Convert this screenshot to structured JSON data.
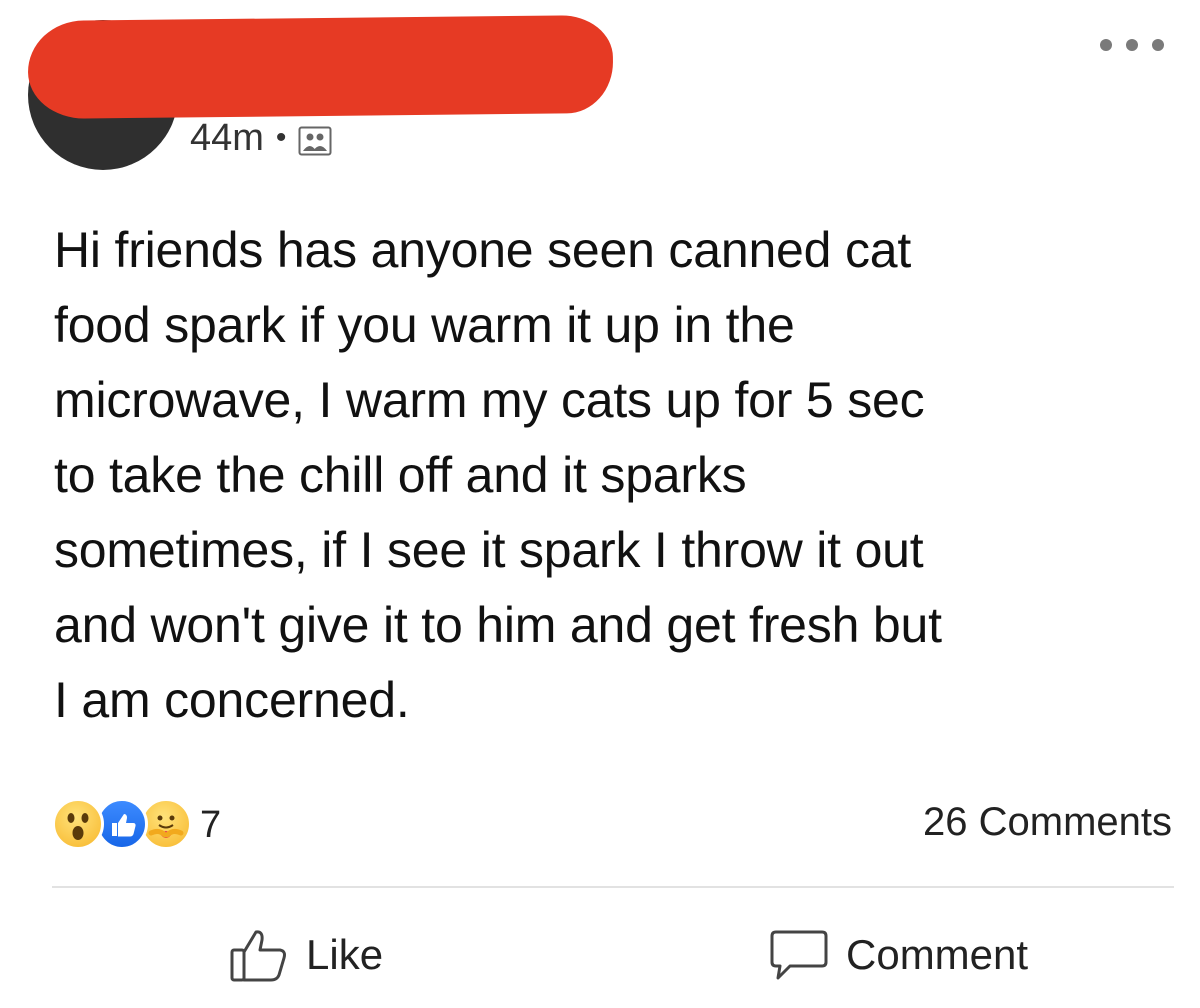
{
  "header": {
    "timestamp": "44m",
    "separator": "•",
    "audience_icon": "friends-icon",
    "more_icon": "more-options-icon"
  },
  "post": {
    "text": "Hi friends has anyone seen canned cat\nfood spark if you warm it up in the\nmicrowave, I warm my cats up for 5 sec\nto take the chill off and it sparks\nsometimes, if I see it spark I throw it out\nand won't give it to him and get fresh but\nI am concerned."
  },
  "stats": {
    "reactions": [
      "wow-reaction-icon",
      "like-reaction-icon",
      "care-reaction-icon"
    ],
    "reaction_count": "7",
    "comments": "26 Comments"
  },
  "actions": {
    "like_label": "Like",
    "comment_label": "Comment"
  },
  "colors": {
    "redaction": "#e63a24",
    "like_blue": "#1766e8",
    "reaction_yellow": "#f7b62a",
    "divider": "#e2e2e2"
  }
}
